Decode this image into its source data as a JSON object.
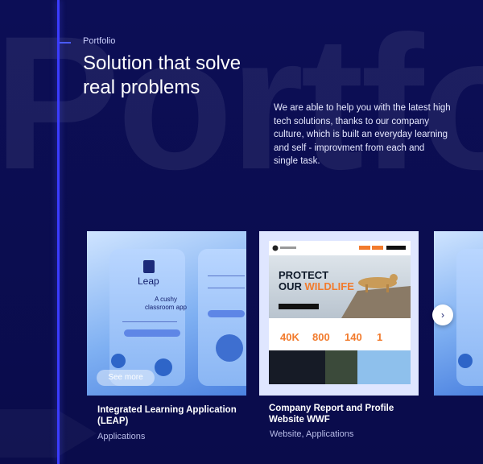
{
  "background_word": "Portfo",
  "header": {
    "eyebrow": "Portfolio",
    "title": "Solution that solve real problems",
    "description": "We are able to help you with the latest high tech solutions, thanks to our company culture, which is built an everyday learning and self - improvment from each and single task."
  },
  "cards": [
    {
      "title": "Integrated Learning Application (LEAP)",
      "category": "Applications",
      "cta": "See more",
      "preview": {
        "brand": "Leap",
        "tagline": "A cushy classroom app"
      }
    },
    {
      "title": "Company Report and Profile Website  WWF",
      "category": "Website, Applications",
      "preview": {
        "headline_1": "PROTECT",
        "headline_2": "OUR ",
        "headline_highlight": "WILDLIFE",
        "stats": [
          "40K",
          "800",
          "140",
          "1"
        ]
      }
    }
  ],
  "next_arrow": "›",
  "colors": {
    "background": "#0b0d52",
    "accent_line": "#3b3cff",
    "wwf_orange": "#f27b2d"
  }
}
